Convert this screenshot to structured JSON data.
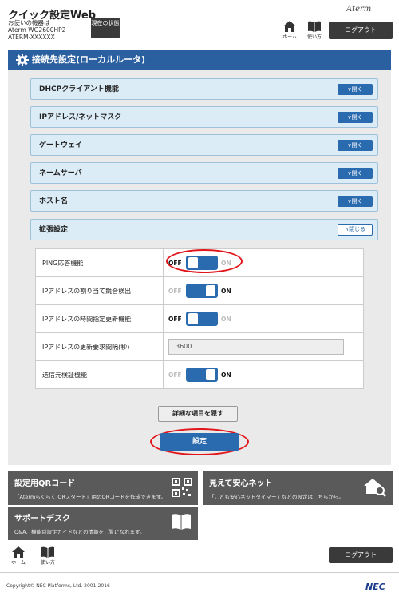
{
  "header": {
    "app_title": "クイック設定Web",
    "device_label": "お使いの機器は",
    "device_model": "Aterm WG2600HP2",
    "device_id": "ATERM-XXXXXX",
    "status_button": "現在の状態",
    "brand": "Aterm",
    "home_label": "ホーム",
    "manual_label": "使い方",
    "logout_label": "ログアウト"
  },
  "section": {
    "title": "接続先設定(ローカルルータ)"
  },
  "accordions": [
    {
      "label": "DHCPクライアント機能",
      "button": "開く"
    },
    {
      "label": "IPアドレス/ネットマスク",
      "button": "開く"
    },
    {
      "label": "ゲートウェイ",
      "button": "開く"
    },
    {
      "label": "ネームサーバ",
      "button": "開く"
    },
    {
      "label": "ホスト名",
      "button": "開く"
    },
    {
      "label": "拡張設定",
      "button": "閉じる"
    }
  ],
  "extended": {
    "rows": [
      {
        "label": "PING応答機能",
        "type": "toggle",
        "state": "OFF"
      },
      {
        "label": "IPアドレスの割り当て競合検出",
        "type": "toggle",
        "state": "ON"
      },
      {
        "label": "IPアドレスの時間指定更新機能",
        "type": "toggle",
        "state": "OFF"
      },
      {
        "label": "IPアドレスの更新要求間隔(秒)",
        "type": "input",
        "value": "3600"
      },
      {
        "label": "送信元検証機能",
        "type": "toggle",
        "state": "ON"
      }
    ],
    "off_text": "OFF",
    "on_text": "ON"
  },
  "actions": {
    "detail_button": "詳細な項目を隠す",
    "set_button": "設定"
  },
  "cards": [
    {
      "title": "設定用QRコード",
      "desc": "「Atermらくらく QRスタート」用のQRコードを作成できます。"
    },
    {
      "title": "見えて安心ネット",
      "desc": "「こども安心ネットタイマー」などの設定はこちらから。"
    },
    {
      "title": "サポートデスク",
      "desc": "Q&A、機能別設定ガイドなどの情報をご覧になれます。"
    }
  ],
  "footer": {
    "home_label": "ホーム",
    "manual_label": "使い方",
    "logout_label": "ログアウト",
    "copyright": "Copyright© NEC Platforms, Ltd. 2001-2016",
    "logo": "NEC"
  },
  "colors": {
    "accent": "#2a6bb0",
    "section_bar": "#2a5fa0",
    "highlight_circle": "#e0161b"
  }
}
